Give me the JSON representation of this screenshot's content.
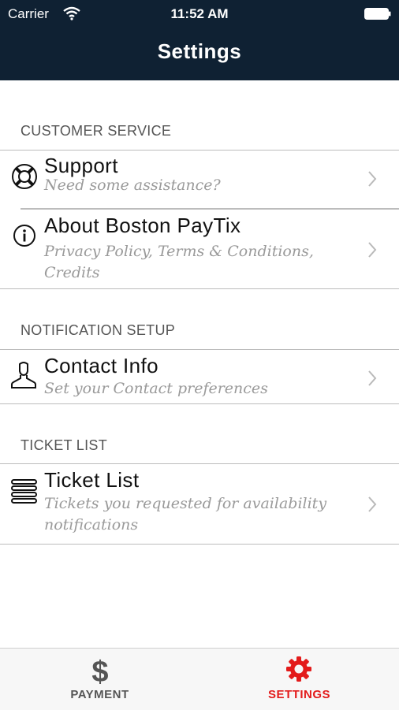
{
  "status_bar": {
    "carrier": "Carrier",
    "time": "11:52 AM"
  },
  "header": {
    "title": "Settings"
  },
  "sections": [
    {
      "title": "CUSTOMER SERVICE",
      "items": [
        {
          "title": "Support",
          "subtitle": "Need some assistance?",
          "icon": "lifebuoy-icon"
        },
        {
          "title": "About Boston PayTix",
          "subtitle": "Privacy Policy, Terms & Conditions, Credits",
          "icon": "info-icon"
        }
      ]
    },
    {
      "title": "NOTIFICATION SETUP",
      "items": [
        {
          "title": "Contact Info",
          "subtitle": "Set your Contact preferences",
          "icon": "user-icon"
        }
      ]
    },
    {
      "title": "TICKET LIST",
      "items": [
        {
          "title": "Ticket List",
          "subtitle": "Tickets you requested for availability notifications",
          "icon": "list-icon"
        }
      ]
    }
  ],
  "tabbar": {
    "tabs": [
      {
        "label": "PAYMENT",
        "icon": "dollar-icon",
        "color": "#555555"
      },
      {
        "label": "SETTINGS",
        "icon": "gear-icon",
        "color": "#e31b1b",
        "active": true
      }
    ]
  },
  "colors": {
    "header_bg": "#0f2133",
    "accent": "#e31b1b"
  }
}
